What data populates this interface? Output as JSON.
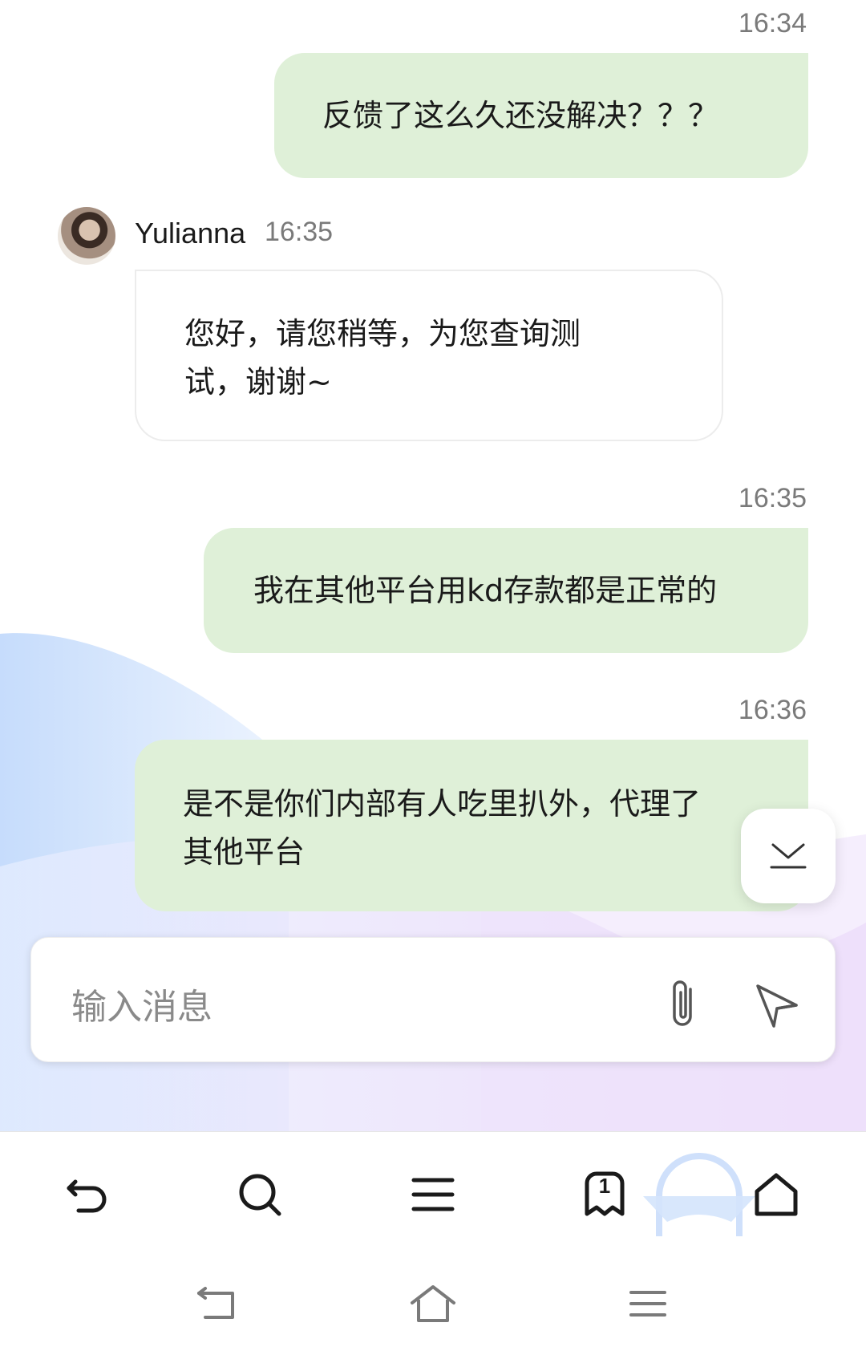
{
  "messages": [
    {
      "time": "16:34",
      "text": "反馈了这么久还没解决？？？"
    },
    {
      "sender": "Yulianna",
      "time": "16:35",
      "text_line1": "您好，请您稍等，为您查询测",
      "text_line2": "试，谢谢~"
    },
    {
      "time": "16:35",
      "text": "我在其他平台用kd存款都是正常的"
    },
    {
      "time": "16:36",
      "text_line1": "是不是你们内部有人吃里扒外，代理了",
      "text_line2": "其他平台"
    }
  ],
  "composer": {
    "placeholder": "输入消息"
  },
  "toolbar": {
    "tab_count": "1"
  },
  "icons": {
    "scroll": "chevron-down-line-icon",
    "attach": "paperclip-icon",
    "send": "send-icon",
    "toolbar": [
      "back-icon",
      "search-icon",
      "menu-icon",
      "tabs-icon",
      "home-icon"
    ],
    "system": [
      "system-back-icon",
      "system-home-icon",
      "system-menu-icon"
    ]
  },
  "colors": {
    "outgoing_bubble": "#dff0d8",
    "incoming_bubble": "#ffffff",
    "accent": "#8fb3f0"
  }
}
